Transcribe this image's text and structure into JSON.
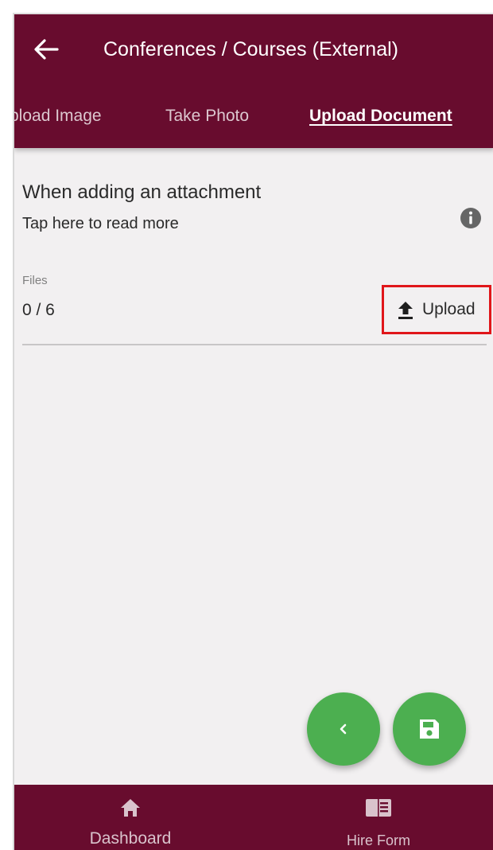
{
  "header": {
    "title": "Conferences / Courses (External)",
    "back_icon": "arrow-left-icon"
  },
  "tabs": [
    {
      "label": "pload Image",
      "active": false
    },
    {
      "label": "Take Photo",
      "active": false
    },
    {
      "label": "Upload Document",
      "active": true
    }
  ],
  "info": {
    "title": "When adding an attachment",
    "subtitle": "Tap here to read more",
    "icon": "info-icon"
  },
  "files": {
    "label": "Files",
    "count": "0 / 6",
    "upload_label": "Upload",
    "upload_icon": "upload-icon"
  },
  "fabs": {
    "back_icon": "chevron-left-icon",
    "save_icon": "save-icon",
    "color": "#4caf50"
  },
  "bottom_nav": {
    "items": [
      {
        "label": "Dashboard",
        "icon": "home-icon"
      },
      {
        "label": "Hire Form",
        "icon": "form-icon"
      }
    ]
  },
  "colors": {
    "brand": "#680c2e",
    "background": "#f2f0f1",
    "highlight": "#e0161a"
  }
}
